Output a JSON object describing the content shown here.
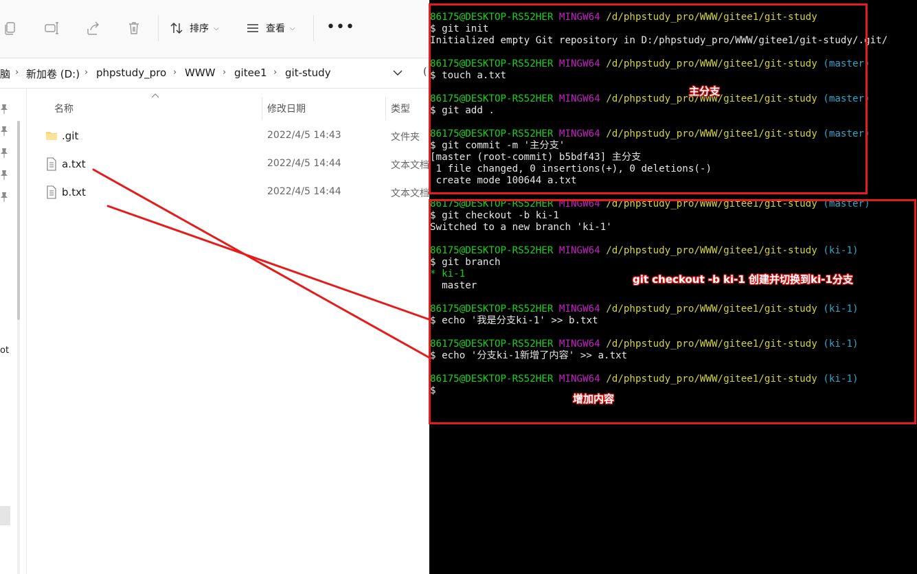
{
  "explorer": {
    "toolbar": {
      "sort_label": "排序",
      "view_label": "查看",
      "more_label": "•••"
    },
    "breadcrumb": [
      "脑",
      "新加卷 (D:)",
      "phpstudy_pro",
      "WWW",
      "gitee1",
      "git-study"
    ],
    "address_edge": "(",
    "nav_partial_text": "ot",
    "columns": {
      "name": "名称",
      "date": "修改日期",
      "type": "类型"
    },
    "files": [
      {
        "name": ".git",
        "date": "2022/4/5 14:43",
        "type": "文件夹",
        "icon": "folder-icon"
      },
      {
        "name": "a.txt",
        "date": "2022/4/5 14:44",
        "type": "文本文档",
        "icon": "text-file-icon"
      },
      {
        "name": "b.txt",
        "date": "2022/4/5 14:44",
        "type": "文本文档",
        "icon": "text-file-icon"
      }
    ]
  },
  "terminal": {
    "prompt_user": "86175@DESKTOP-RS52HER",
    "prompt_sys": "MINGW64",
    "prompt_path": "/d/phpstudy_pro/WWW/gitee1/git-study",
    "lines": [
      {
        "kind": "prompt",
        "branch": ""
      },
      {
        "kind": "text",
        "text": "$ git init"
      },
      {
        "kind": "text",
        "text": "Initialized empty Git repository in D:/phpstudy_pro/WWW/gitee1/git-study/.git/"
      },
      {
        "kind": "blank"
      },
      {
        "kind": "prompt",
        "branch": " (master)"
      },
      {
        "kind": "text",
        "text": "$ touch a.txt"
      },
      {
        "kind": "blank"
      },
      {
        "kind": "prompt",
        "branch": " (master)"
      },
      {
        "kind": "text",
        "text": "$ git add ."
      },
      {
        "kind": "blank"
      },
      {
        "kind": "prompt",
        "branch": " (master)"
      },
      {
        "kind": "text",
        "text": "$ git commit -m '主分支'"
      },
      {
        "kind": "text",
        "text": "[master (root-commit) b5bdf43] 主分支"
      },
      {
        "kind": "text",
        "text": " 1 file changed, 0 insertions(+), 0 deletions(-)"
      },
      {
        "kind": "text",
        "text": " create mode 100644 a.txt"
      },
      {
        "kind": "blank"
      },
      {
        "kind": "prompt",
        "branch": " (master)"
      },
      {
        "kind": "text",
        "text": "$ git checkout -b ki-1"
      },
      {
        "kind": "text",
        "text": "Switched to a new branch 'ki-1'"
      },
      {
        "kind": "blank"
      },
      {
        "kind": "prompt",
        "branch": " (ki-1)"
      },
      {
        "kind": "text",
        "text": "$ git branch"
      },
      {
        "kind": "star",
        "text": "* ki-1"
      },
      {
        "kind": "text",
        "text": "  master"
      },
      {
        "kind": "blank"
      },
      {
        "kind": "prompt",
        "branch": " (ki-1)"
      },
      {
        "kind": "text",
        "text": "$ echo '我是分支ki-1' >> b.txt"
      },
      {
        "kind": "blank"
      },
      {
        "kind": "prompt",
        "branch": " (ki-1)"
      },
      {
        "kind": "text",
        "text": "$ echo '分支ki-1新增了内容' >> a.txt"
      },
      {
        "kind": "blank"
      },
      {
        "kind": "prompt",
        "branch": " (ki-1)"
      },
      {
        "kind": "cursor",
        "text": "$"
      }
    ]
  },
  "annotations": {
    "main_branch_label": "主分支",
    "checkout_note": "git checkout -b ki-1 创建并切换到ki-1分支",
    "added_content_note": "增加内容"
  },
  "colors": {
    "terminal_bg": "#000000",
    "prompt_user": "#17d317",
    "prompt_sys": "#c321c3",
    "prompt_path": "#d3d33a",
    "prompt_branch": "#2aa7c9",
    "annotation_red": "#e41c1c"
  }
}
